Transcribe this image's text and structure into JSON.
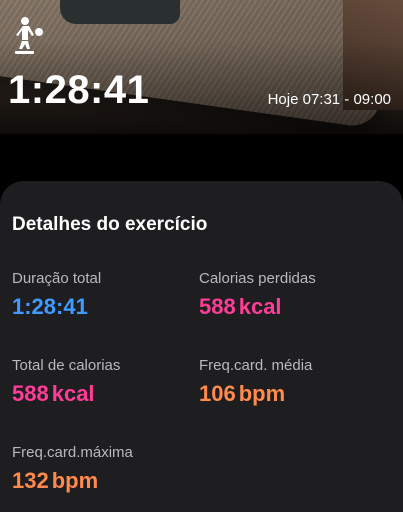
{
  "header": {
    "activity_icon": "volleyball-player-icon",
    "duration": "1:28:41",
    "time_range": "Hoje 07:31 - 09:00"
  },
  "details": {
    "title": "Detalhes do exercício",
    "total_duration": {
      "label": "Duração total",
      "value": "1:28:41"
    },
    "calories_burned": {
      "label": "Calorias perdidas",
      "number": "588",
      "unit": "kcal"
    },
    "total_calories": {
      "label": "Total de calorias",
      "number": "588",
      "unit": "kcal"
    },
    "avg_heart_rate": {
      "label": "Freq.card. média",
      "number": "106",
      "unit": "bpm"
    },
    "max_heart_rate": {
      "label": "Freq.card.máxima",
      "number": "132",
      "unit": "bpm"
    }
  },
  "colors": {
    "duration": "#3f9bff",
    "calories": "#ff3c96",
    "heart_rate": "#ff8a4c",
    "card_background": "#1e1e21"
  }
}
